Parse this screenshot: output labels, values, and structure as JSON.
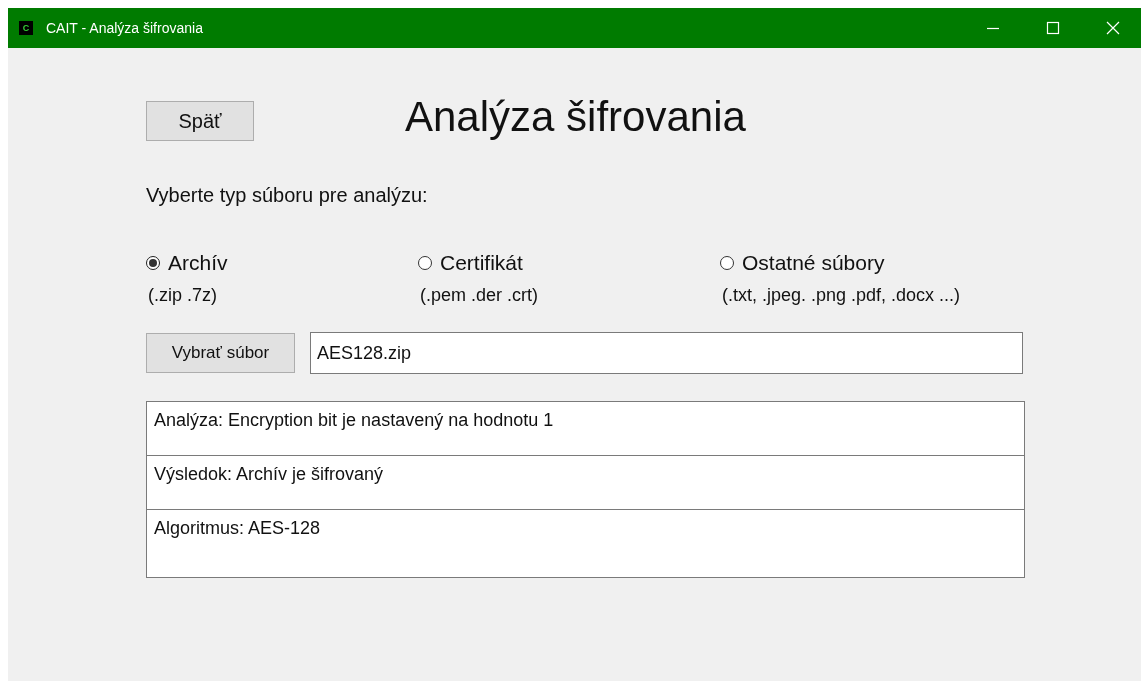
{
  "window": {
    "title": "CAIT - Analýza šifrovania",
    "icon_letter": "C"
  },
  "back_button": "Späť",
  "heading": "Analýza šifrovania",
  "prompt": "Vyberte typ súboru pre analýzu:",
  "file_types": [
    {
      "label": "Archív",
      "extensions": "(.zip .7z)",
      "selected": true
    },
    {
      "label": "Certifikát",
      "extensions": "(.pem .der .crt)",
      "selected": false
    },
    {
      "label": "Ostatné súbory",
      "extensions": "(.txt, .jpeg. .png .pdf, .docx ...)",
      "selected": false
    }
  ],
  "choose_button": "Vybrať súbor",
  "file_field": {
    "value": "AES128.zip"
  },
  "results": [
    "Analýza: Encryption bit je nastavený na hodnotu 1",
    "Výsledok: Archív je šifrovaný",
    "Algoritmus: AES-128"
  ]
}
